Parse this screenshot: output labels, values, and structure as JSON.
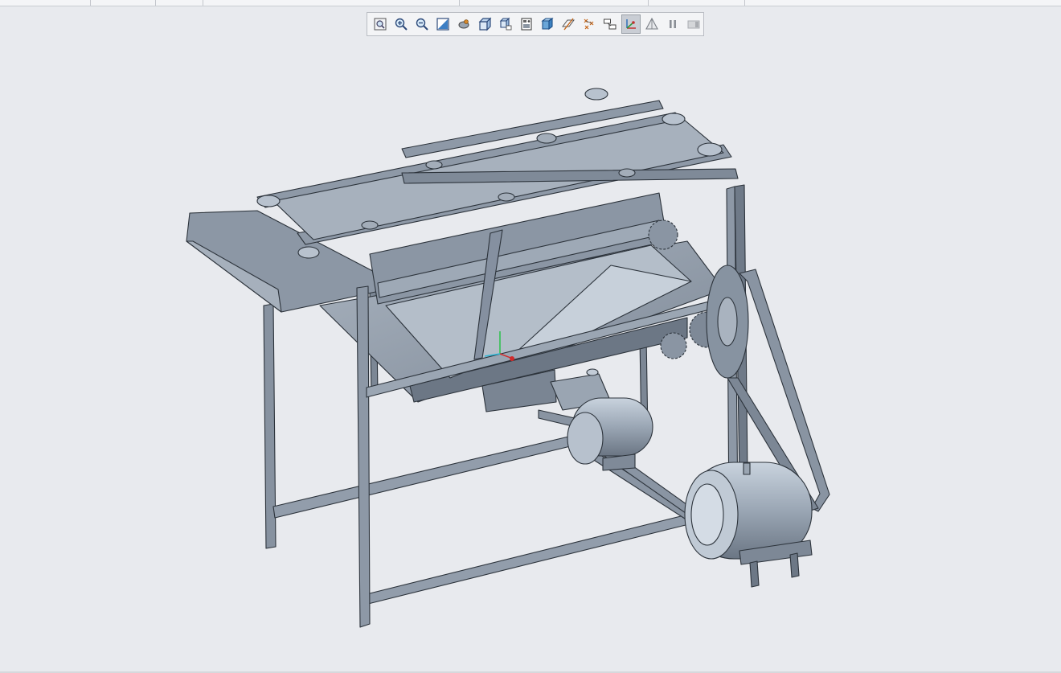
{
  "window": {
    "title": ""
  },
  "toolbar": {
    "buttons": [
      {
        "icon": "refit-icon"
      },
      {
        "icon": "zoom-in-icon"
      },
      {
        "icon": "zoom-out-icon"
      },
      {
        "icon": "repaint-icon"
      },
      {
        "icon": "spin-center-icon"
      },
      {
        "icon": "view-cube-icon"
      },
      {
        "icon": "saved-views-icon"
      },
      {
        "icon": "display-style-icon"
      },
      {
        "icon": "shaded-icon"
      },
      {
        "icon": "datum-planes-icon"
      },
      {
        "icon": "datum-points-icon"
      },
      {
        "icon": "annotation-icon"
      },
      {
        "icon": "csys-display-icon",
        "active": true
      },
      {
        "icon": "perspective-icon"
      },
      {
        "icon": "pause-icon"
      },
      {
        "icon": "disabled-tool-icon"
      }
    ]
  },
  "viewport": {
    "model": "cad-assembly",
    "background": "#e8eaee",
    "colors": {
      "metal": "#8a96a6",
      "metal_dark": "#5d6875",
      "metal_light": "#b7c1cd",
      "edge": "#2c333b"
    }
  }
}
